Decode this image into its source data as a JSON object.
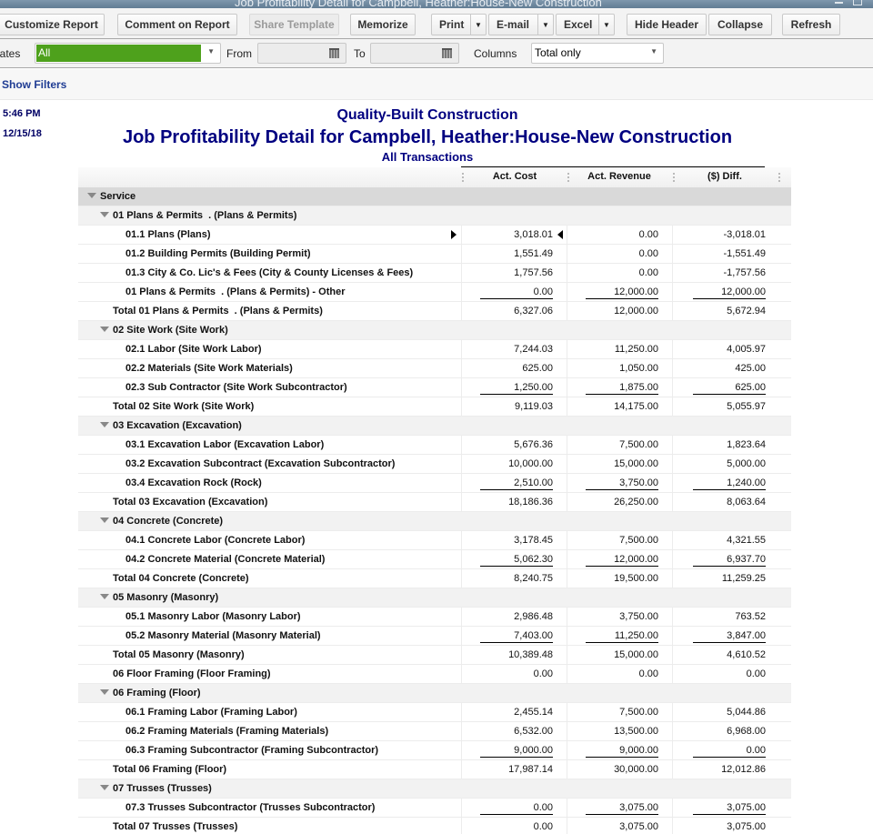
{
  "window": {
    "title": "Job Profitability Detail for Campbell, Heather:House-New Construction"
  },
  "toolbar": {
    "customize_report": "Customize Report",
    "comment_on_report": "Comment on Report",
    "share_template": "Share Template",
    "memorize": "Memorize",
    "print": "Print",
    "email": "E-mail",
    "excel": "Excel",
    "hide_header": "Hide Header",
    "collapse": "Collapse",
    "refresh": "Refresh"
  },
  "filters": {
    "dates_label": "Dates",
    "dates_value": "All",
    "from_label": "From",
    "from_value": "",
    "to_label": "To",
    "to_value": "",
    "columns_label": "Columns",
    "columns_value": "Total only",
    "show_filters": "Show Filters"
  },
  "report": {
    "time": "5:46 PM",
    "date": "12/15/18",
    "company": "Quality-Built Construction",
    "title": "Job Profitability Detail for Campbell, Heather:House-New Construction",
    "subtitle": "All Transactions",
    "columns": [
      "Act. Cost",
      "Act. Revenue",
      "($) Diff."
    ],
    "rows": [
      {
        "type": "section",
        "label": "Service"
      },
      {
        "type": "group",
        "label": "01 Plans & Permits  . (Plans & Permits)"
      },
      {
        "type": "item",
        "label": "01.1 Plans (Plans)",
        "cost": "3,018.01",
        "revenue": "0.00",
        "diff": "-3,018.01",
        "selected": true
      },
      {
        "type": "item",
        "label": "01.2 Building Permits (Building Permit)",
        "cost": "1,551.49",
        "revenue": "0.00",
        "diff": "-1,551.49"
      },
      {
        "type": "item",
        "label": "01.3 City & Co. Lic's & Fees (City & County Licenses & Fees)",
        "cost": "1,757.56",
        "revenue": "0.00",
        "diff": "-1,757.56"
      },
      {
        "type": "item",
        "label": "01 Plans & Permits  . (Plans & Permits) - Other",
        "cost": "0.00",
        "revenue": "12,000.00",
        "diff": "12,000.00",
        "underline": true
      },
      {
        "type": "total",
        "label": "Total 01 Plans & Permits  . (Plans & Permits)",
        "cost": "6,327.06",
        "revenue": "12,000.00",
        "diff": "5,672.94"
      },
      {
        "type": "group",
        "label": "02 Site Work (Site Work)"
      },
      {
        "type": "item",
        "label": "02.1 Labor (Site Work Labor)",
        "cost": "7,244.03",
        "revenue": "11,250.00",
        "diff": "4,005.97"
      },
      {
        "type": "item",
        "label": "02.2 Materials (Site Work Materials)",
        "cost": "625.00",
        "revenue": "1,050.00",
        "diff": "425.00"
      },
      {
        "type": "item",
        "label": "02.3 Sub Contractor (Site Work Subcontractor)",
        "cost": "1,250.00",
        "revenue": "1,875.00",
        "diff": "625.00",
        "underline": true
      },
      {
        "type": "total",
        "label": "Total 02 Site Work (Site Work)",
        "cost": "9,119.03",
        "revenue": "14,175.00",
        "diff": "5,055.97"
      },
      {
        "type": "group",
        "label": "03 Excavation (Excavation)"
      },
      {
        "type": "item",
        "label": "03.1 Excavation Labor (Excavation Labor)",
        "cost": "5,676.36",
        "revenue": "7,500.00",
        "diff": "1,823.64"
      },
      {
        "type": "item",
        "label": "03.2 Excavation Subcontract (Excavation Subcontractor)",
        "cost": "10,000.00",
        "revenue": "15,000.00",
        "diff": "5,000.00"
      },
      {
        "type": "item",
        "label": "03.4 Excavation Rock (Rock)",
        "cost": "2,510.00",
        "revenue": "3,750.00",
        "diff": "1,240.00",
        "underline": true
      },
      {
        "type": "total",
        "label": "Total 03 Excavation (Excavation)",
        "cost": "18,186.36",
        "revenue": "26,250.00",
        "diff": "8,063.64"
      },
      {
        "type": "group",
        "label": "04 Concrete (Concrete)"
      },
      {
        "type": "item",
        "label": "04.1 Concrete Labor (Concrete Labor)",
        "cost": "3,178.45",
        "revenue": "7,500.00",
        "diff": "4,321.55"
      },
      {
        "type": "item",
        "label": "04.2 Concrete Material (Concrete Material)",
        "cost": "5,062.30",
        "revenue": "12,000.00",
        "diff": "6,937.70",
        "underline": true
      },
      {
        "type": "total",
        "label": "Total 04 Concrete (Concrete)",
        "cost": "8,240.75",
        "revenue": "19,500.00",
        "diff": "11,259.25"
      },
      {
        "type": "group",
        "label": "05 Masonry (Masonry)"
      },
      {
        "type": "item",
        "label": "05.1 Masonry Labor (Masonry Labor)",
        "cost": "2,986.48",
        "revenue": "3,750.00",
        "diff": "763.52"
      },
      {
        "type": "item",
        "label": "05.2 Masonry Material (Masonry Material)",
        "cost": "7,403.00",
        "revenue": "11,250.00",
        "diff": "3,847.00",
        "underline": true
      },
      {
        "type": "total",
        "label": "Total 05 Masonry (Masonry)",
        "cost": "10,389.48",
        "revenue": "15,000.00",
        "diff": "4,610.52"
      },
      {
        "type": "total",
        "label": "06 Floor Framing (Floor Framing)",
        "cost": "0.00",
        "revenue": "0.00",
        "diff": "0.00"
      },
      {
        "type": "group",
        "label": "06 Framing (Floor)"
      },
      {
        "type": "item",
        "label": "06.1 Framing Labor (Framing Labor)",
        "cost": "2,455.14",
        "revenue": "7,500.00",
        "diff": "5,044.86"
      },
      {
        "type": "item",
        "label": "06.2 Framing Materials (Framing Materials)",
        "cost": "6,532.00",
        "revenue": "13,500.00",
        "diff": "6,968.00"
      },
      {
        "type": "item",
        "label": "06.3 Framing Subcontractor (Framing Subcontractor)",
        "cost": "9,000.00",
        "revenue": "9,000.00",
        "diff": "0.00",
        "underline": true
      },
      {
        "type": "total",
        "label": "Total 06 Framing (Floor)",
        "cost": "17,987.14",
        "revenue": "30,000.00",
        "diff": "12,012.86"
      },
      {
        "type": "group",
        "label": "07 Trusses (Trusses)"
      },
      {
        "type": "item",
        "label": "07.3 Trusses Subcontractor (Trusses Subcontractor)",
        "cost": "0.00",
        "revenue": "3,075.00",
        "diff": "3,075.00",
        "underline": true
      },
      {
        "type": "total",
        "label": "Total 07 Trusses (Trusses)",
        "cost": "0.00",
        "revenue": "3,075.00",
        "diff": "3,075.00"
      }
    ]
  }
}
